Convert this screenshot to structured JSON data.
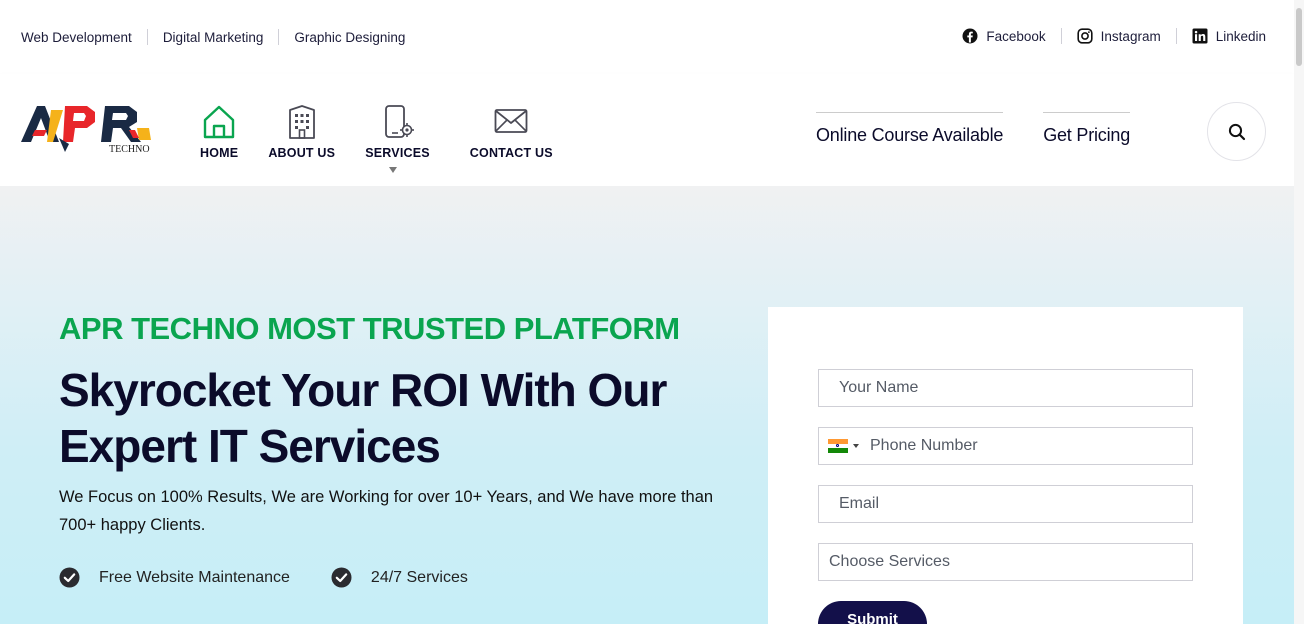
{
  "topbar": {
    "links": [
      "Web Development",
      "Digital Marketing",
      "Graphic Designing"
    ],
    "social": [
      {
        "label": "Facebook",
        "icon": "facebook-icon"
      },
      {
        "label": "Instagram",
        "icon": "instagram-icon"
      },
      {
        "label": "Linkedin",
        "icon": "linkedin-icon"
      }
    ]
  },
  "header": {
    "logo_text": "APR",
    "logo_subtext": "TECHNO",
    "nav": [
      {
        "label": "HOME",
        "icon": "home-icon"
      },
      {
        "label": "ABOUT US",
        "icon": "building-icon"
      },
      {
        "label": "SERVICES",
        "icon": "mobile-gear-icon"
      },
      {
        "label": "CONTACT US",
        "icon": "envelope-icon"
      }
    ],
    "cta_course": "Online Course Available",
    "cta_pricing": "Get Pricing",
    "search_icon": "search-icon"
  },
  "hero": {
    "eyebrow": "APR TECHNO MOST TRUSTED PLATFORM",
    "headline": "Skyrocket Your ROI With Our Expert IT Services",
    "description": "We Focus on 100% Results,  We are Working for over 10+ Years, and We have more than 700+ happy Clients.",
    "features": [
      "Free Website Maintenance",
      "24/7 Services"
    ]
  },
  "form": {
    "name_placeholder": "Your Name",
    "phone_placeholder": "Phone Number",
    "email_placeholder": "Email",
    "services_placeholder": "Choose Services",
    "submit_label": "Submit"
  },
  "colors": {
    "accent_green": "#0aa54f",
    "navy": "#13104a",
    "text_dark": "#0b0b2a",
    "logo_red": "#e8262a",
    "logo_yellow": "#f5b21a"
  }
}
